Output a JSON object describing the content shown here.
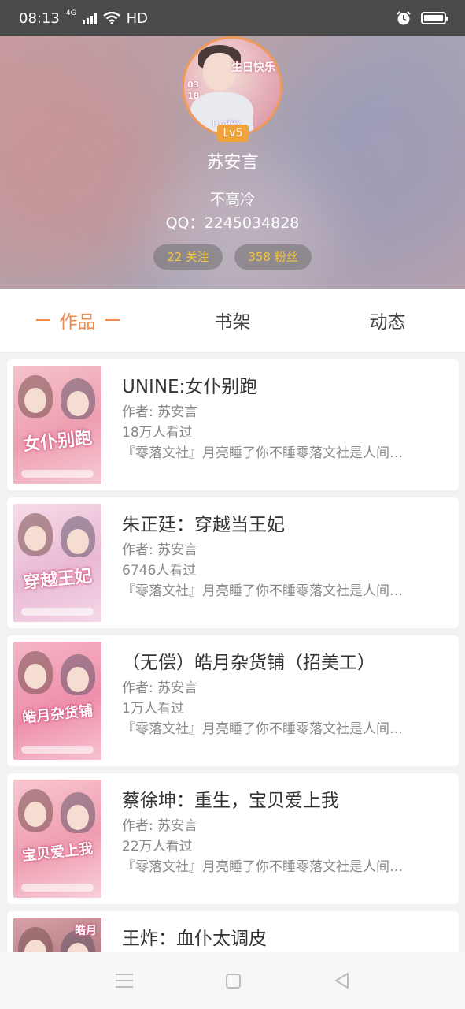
{
  "status_bar": {
    "time": "08:13",
    "network": "4G",
    "hd": "HD"
  },
  "profile": {
    "level": "Lv5",
    "name": "苏安言",
    "signature": "不高冷",
    "qq": "QQ：2245034828",
    "following": "22 关注",
    "fans": "358 粉丝",
    "avatar_text": {
      "date_top": "03",
      "date_bottom": "18",
      "birthday": "生日快乐",
      "happy": "HAPPY"
    }
  },
  "tabs": [
    {
      "label": "作品",
      "active": true
    },
    {
      "label": "书架",
      "active": false
    },
    {
      "label": "动态",
      "active": false
    }
  ],
  "works": [
    {
      "title": "UNINE:女仆别跑",
      "author": "作者: 苏安言",
      "views": "18万人看过",
      "desc": "『零落文社』月亮睡了你不睡零落文社是人间…",
      "cover_text": "女仆别跑"
    },
    {
      "title": "朱正廷：穿越当王妃",
      "author": "作者: 苏安言",
      "views": "6746人看过",
      "desc": "『零落文社』月亮睡了你不睡零落文社是人间…",
      "cover_text": "穿越王妃"
    },
    {
      "title": "（无偿）皓月杂货铺（招美工）",
      "author": "作者: 苏安言",
      "views": "1万人看过",
      "desc": "『零落文社』月亮睡了你不睡零落文社是人间…",
      "cover_text": "皓月杂货铺"
    },
    {
      "title": "蔡徐坤：重生，宝贝爱上我",
      "author": "作者: 苏安言",
      "views": "22万人看过",
      "desc": "『零落文社』月亮睡了你不睡零落文社是人间…",
      "cover_text": "宝贝爱上我"
    },
    {
      "title": "王炸：血仆太调皮",
      "author": "",
      "views": "",
      "desc": "",
      "cover_text": "皓月"
    }
  ],
  "colors": {
    "accent": "#f08a4b",
    "level_badge": "#f0a23c",
    "pill_text": "#f5c63c"
  },
  "icons": {
    "nav": [
      "menu-icon",
      "home-icon",
      "back-icon"
    ],
    "status": [
      "signal-icon",
      "wifi-icon",
      "alarm-icon",
      "battery-icon"
    ]
  }
}
